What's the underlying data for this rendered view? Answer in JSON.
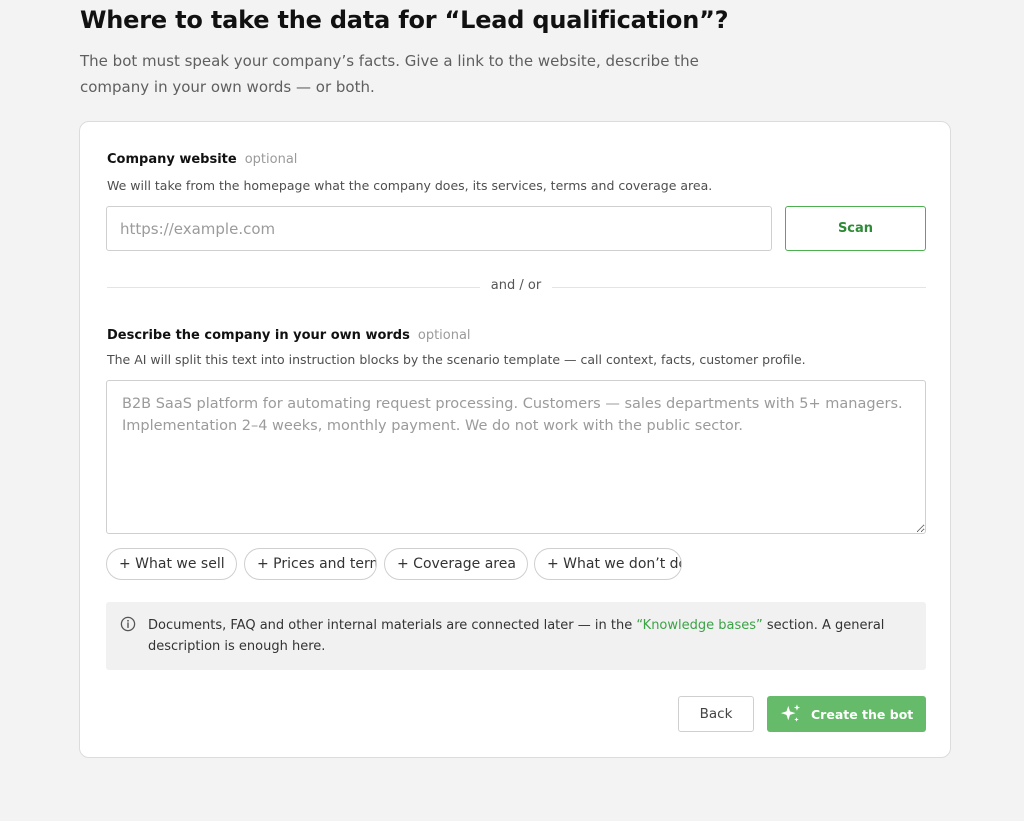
{
  "header": {
    "title": "Where to take the data for “Lead qualification”?",
    "subtitle": "The bot must speak your company’s facts. Give a link to the website, describe the company in your own words — or both."
  },
  "website": {
    "label": "Company website",
    "optional": "optional",
    "hint": "We will take from the homepage what the company does, its services, terms and coverage area.",
    "placeholder": "https://example.com",
    "value": "",
    "scan_label": "Scan"
  },
  "divider": {
    "text": "and / or"
  },
  "description": {
    "label": "Describe the company in your own words",
    "optional": "optional",
    "hint": "The AI will split this text into instruction blocks by the scenario template — call context, facts, customer profile.",
    "placeholder": "B2B SaaS platform for automating request processing. Customers — sales departments with 5+ managers. Implementation 2–4 weeks, monthly payment. We do not work with the public sector.",
    "value": ""
  },
  "chips": [
    {
      "label": "+ What we sell"
    },
    {
      "label": "+ Prices and terms"
    },
    {
      "label": "+ Coverage area"
    },
    {
      "label": "+ What we don’t do"
    }
  ],
  "info": {
    "icon": "info-icon",
    "text_before": "Documents, FAQ and other internal materials are connected later — in the ",
    "link_text": "“Knowledge bases”",
    "text_after": " section. A general description is enough here."
  },
  "actions": {
    "back_label": "Back",
    "create_label": "Create the bot",
    "create_icon": "sparkle-icon"
  },
  "colors": {
    "accent": "#66bb6a",
    "accent_dark": "#2e8b36",
    "link": "#3aa346",
    "page_bg": "#f3f3f3"
  }
}
